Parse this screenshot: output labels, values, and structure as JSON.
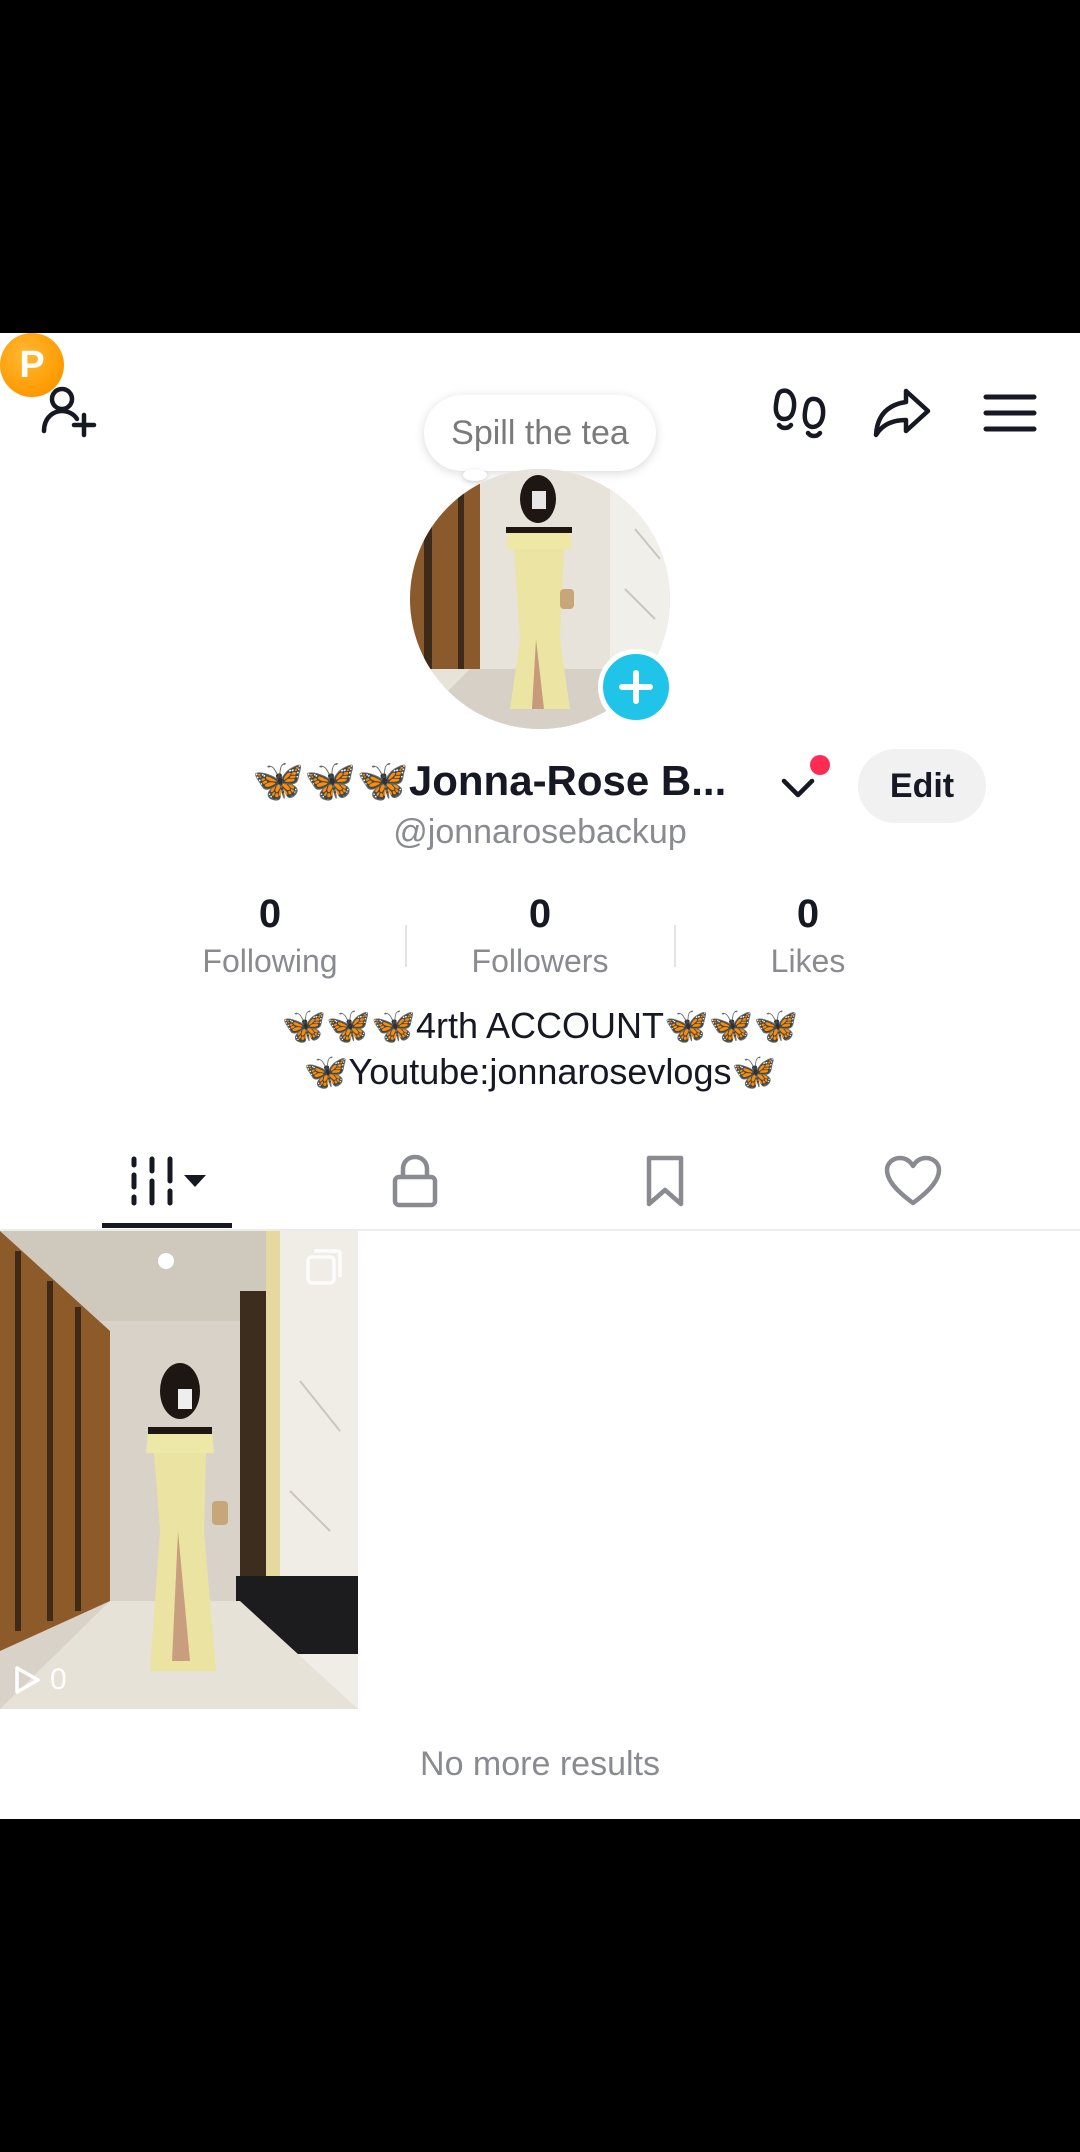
{
  "top_bar": {
    "coin_letter": "P",
    "tooltip": "Spill the tea"
  },
  "profile": {
    "display_name_emoji": "🦋🦋🦋",
    "display_name_text": "Jonna-Rose B...",
    "username": "@jonnarosebackup",
    "edit_label": "Edit"
  },
  "stats": {
    "following_count": "0",
    "following_label": "Following",
    "followers_count": "0",
    "followers_label": "Followers",
    "likes_count": "0",
    "likes_label": "Likes"
  },
  "bio": {
    "line1_prefix": "🦋🦋🦋",
    "line1_text": "4rth ACCOUNT",
    "line1_suffix": "🦋🦋🦋",
    "line2_prefix": "🦋",
    "line2_text": "Youtube:jonnarosevlogs",
    "line2_suffix": "🦋"
  },
  "tabs": [
    {
      "icon": "grid-icon"
    },
    {
      "icon": "lock-icon"
    },
    {
      "icon": "bookmark-icon"
    },
    {
      "icon": "heart-icon"
    }
  ],
  "videos": [
    {
      "views": "0"
    }
  ],
  "footer_text": "No more results",
  "colors": {
    "accent_cyan": "#20c4e8",
    "notification_red": "#fe2c55",
    "coin_orange": "#ff9a00",
    "butterfly_blue": "#2ea8ec"
  }
}
